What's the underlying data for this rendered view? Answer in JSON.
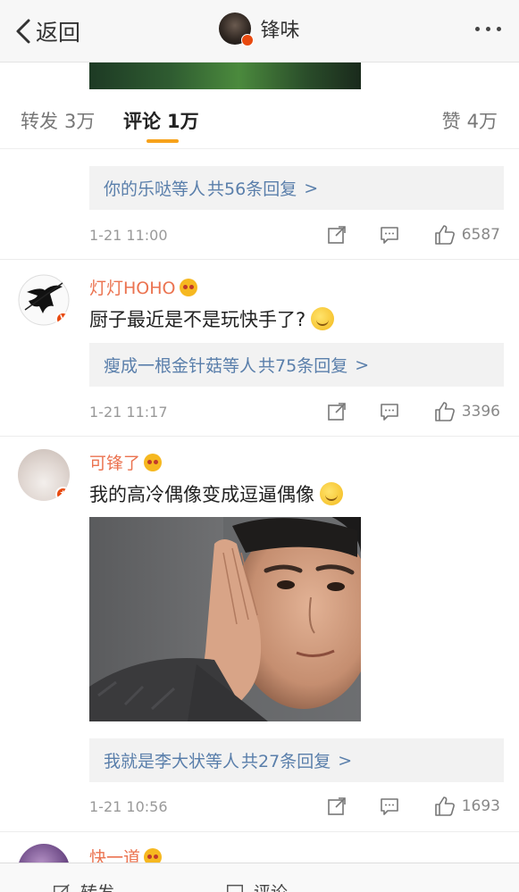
{
  "nav": {
    "back_label": "返回",
    "title": "锋味"
  },
  "tabs": [
    {
      "label": "转发",
      "count": "3万"
    },
    {
      "label": "评论",
      "count": "1万"
    },
    {
      "label": "赞",
      "count": "4万"
    }
  ],
  "comments": [
    {
      "reply_names": "你的乐哒等人",
      "reply_rest": "共56条回复",
      "reply_arrow": ">",
      "time": "1-21 11:00",
      "likes": "6587"
    },
    {
      "username": "灯灯HOHO",
      "text": "厨子最近是不是玩快手了?",
      "reply_names": "瘦成一根金针菇等人",
      "reply_rest": "共75条回复",
      "reply_arrow": ">",
      "time": "1-21 11:17",
      "likes": "3396"
    },
    {
      "username": "可锋了",
      "text": "我的高冷偶像变成逗逼偶像",
      "reply_names": "我就是李大状等人",
      "reply_rest": "共27条回复",
      "reply_arrow": ">",
      "time": "1-21 10:56",
      "likes": "1693"
    },
    {
      "username": "快一道"
    }
  ],
  "bottombar": {
    "repost_label": "转发",
    "comment_label": "评论"
  },
  "colors": {
    "username": "#eb7350",
    "reply_link": "#5a7fab",
    "tab_indicator": "#f7a21b",
    "verified_badge": "#e8490f"
  },
  "icons": [
    "back-chevron-icon",
    "more-dots-icon",
    "vip-crown-icon",
    "emoji-icon",
    "share-icon",
    "comment-icon",
    "like-thumb-icon"
  ]
}
